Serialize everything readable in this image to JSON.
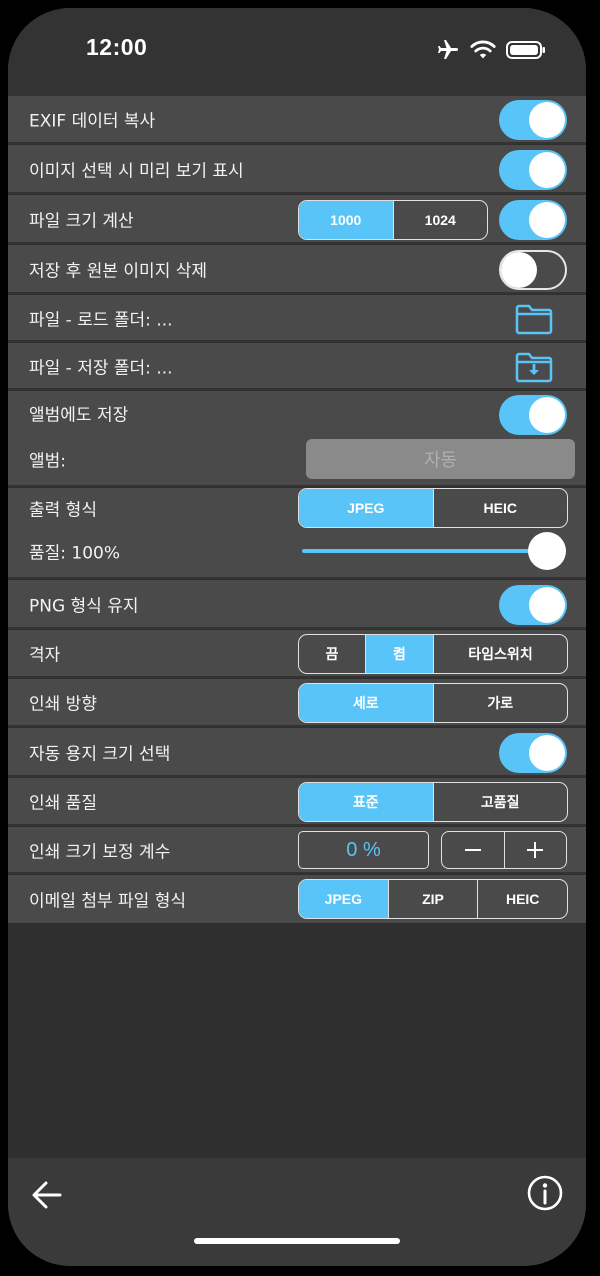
{
  "status": {
    "time": "12:00",
    "icons": [
      "airplane-icon",
      "wifi-icon",
      "battery-icon"
    ]
  },
  "colors": {
    "accent": "#58c4f7",
    "row_bg": "#4a4a4a",
    "screen_bg": "#2f2f2f"
  },
  "settings": {
    "exif_copy": {
      "label": "EXIF 데이터 복사",
      "on": true
    },
    "preview": {
      "label": "이미지 선택 시 미리 보기 표시",
      "on": true
    },
    "file_size": {
      "label": "파일 크기 계산",
      "options": [
        "1000",
        "1024"
      ],
      "selected": "1000",
      "on": true
    },
    "delete_original": {
      "label": "저장 후 원본 이미지 삭제",
      "on": false
    },
    "load_folder": {
      "label": "파일 - 로드 폴더:  ...",
      "icon": "folder-icon"
    },
    "save_folder": {
      "label": "파일 - 저장 폴더:  ...",
      "icon": "folder-download-icon"
    },
    "save_album": {
      "label": "앨범에도 저장",
      "on": true
    },
    "album": {
      "label": "앨범:",
      "button": "자동"
    },
    "output_format": {
      "label": "출력 형식",
      "options": [
        "JPEG",
        "HEIC"
      ],
      "selected": "JPEG"
    },
    "quality": {
      "label": "품질: 100%",
      "value": 100
    },
    "keep_png": {
      "label": "PNG 형식 유지",
      "on": true
    },
    "grid": {
      "label": "격자",
      "options": [
        "끔",
        "켬",
        "타임스위치"
      ],
      "selected": "켬"
    },
    "print_orientation": {
      "label": "인쇄 방향",
      "options": [
        "세로",
        "가로"
      ],
      "selected": "세로"
    },
    "auto_paper": {
      "label": "자동 용지 크기 선택",
      "on": true
    },
    "print_quality": {
      "label": "인쇄 품질",
      "options": [
        "표준",
        "고품질"
      ],
      "selected": "표준"
    },
    "print_scale": {
      "label": "인쇄 크기 보정 계수",
      "value": "0 %"
    },
    "email_format": {
      "label": "이메일 첨부 파일 형식",
      "options": [
        "JPEG",
        "ZIP",
        "HEIC"
      ],
      "selected": "JPEG"
    }
  },
  "toolbar": {
    "back_icon": "back-arrow-icon",
    "info_icon": "info-icon"
  }
}
